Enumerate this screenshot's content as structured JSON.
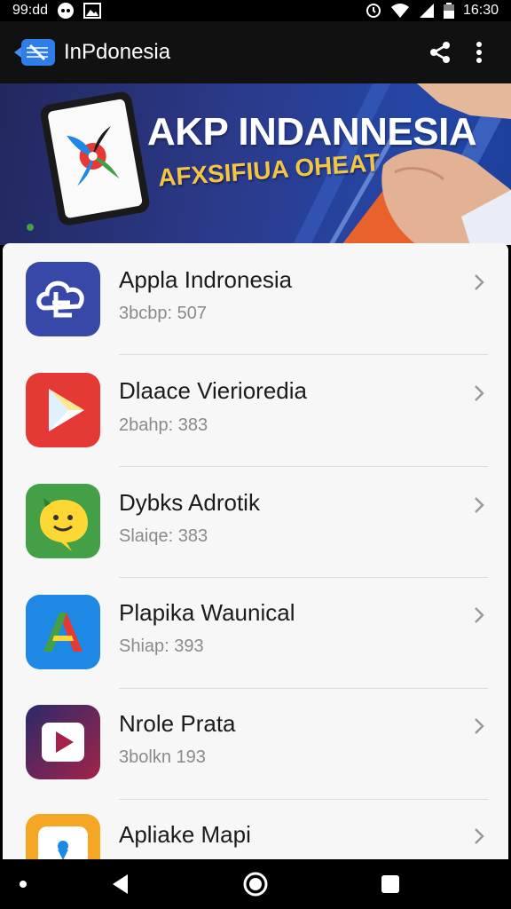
{
  "status_bar": {
    "left_text": "99:dd",
    "time": "16:30",
    "icons": [
      "notification-icon",
      "image-icon",
      "alarm-icon",
      "wifi-icon",
      "signal-icon",
      "battery-icon"
    ]
  },
  "app_bar": {
    "title": "InPdonesia",
    "actions": [
      "share-icon",
      "more-vert-icon"
    ]
  },
  "banner": {
    "title": "AKP INDANNESIA",
    "subtitle": "AFXSIFIUA OHEAT",
    "colors": {
      "background": "#2b3a8a",
      "title": "#ffffff",
      "subtitle": "#f2c447"
    }
  },
  "apps": [
    {
      "name": "Appla Indronesia",
      "subtitle": "3bcbp: 507",
      "icon": "cloud-app-icon",
      "color": "#3848a8"
    },
    {
      "name": "Dlaace Vierioredia",
      "subtitle": "2bahp: 383",
      "icon": "play-app-icon",
      "color": "#e53935"
    },
    {
      "name": "Dybks Adrotik",
      "subtitle": "Slaiqe: 383",
      "icon": "smiley-app-icon",
      "color": "#43a047"
    },
    {
      "name": "Plapika Waunical",
      "subtitle": "Shiap: 393",
      "icon": "letter-a-app-icon",
      "color": "#1e88e5"
    },
    {
      "name": "Nrole Prata",
      "subtitle": "3bolkn 193",
      "icon": "video-app-icon",
      "color": "#8e2448"
    },
    {
      "name": "Apliake Mapi",
      "subtitle": "",
      "icon": "map-app-icon",
      "color": "#f5a623"
    }
  ],
  "nav_bar": {
    "buttons": [
      "back-icon",
      "home-icon",
      "recents-icon"
    ]
  }
}
